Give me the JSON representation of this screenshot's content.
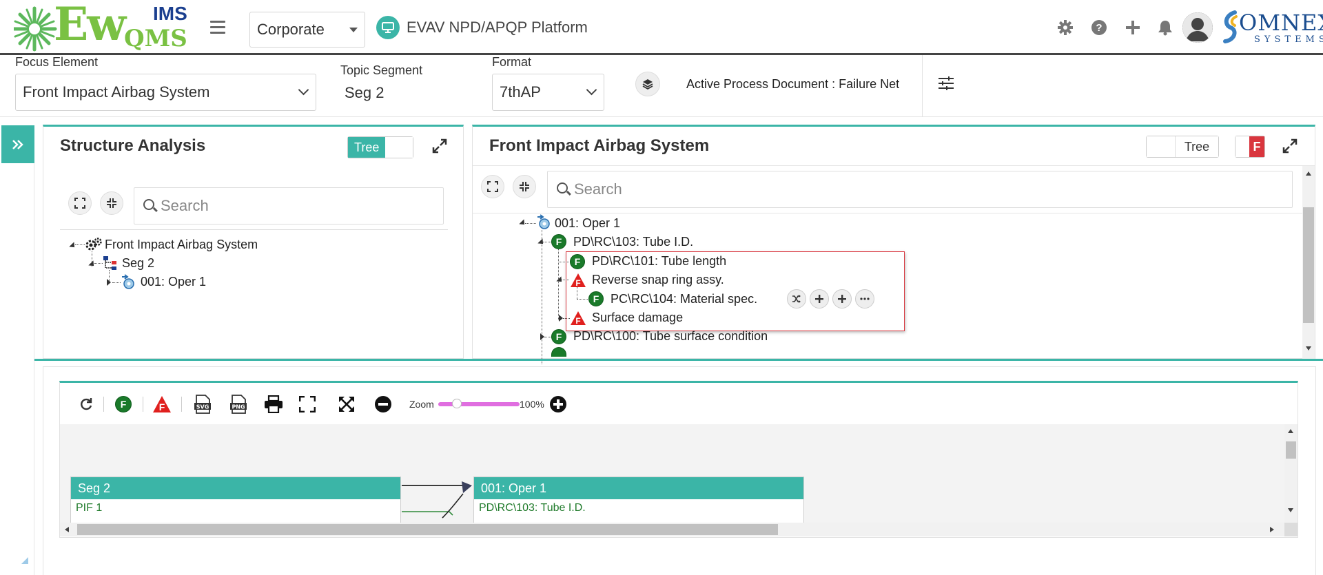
{
  "header": {
    "logo_main": "Ew",
    "logo_ims": "IMS",
    "logo_qms": "QMS",
    "company_select": "Corporate",
    "platform_title": "EVAV NPD/APQP Platform",
    "brand_name": "OMNEX",
    "brand_sub": "SYSTEMS",
    "icons": [
      "gear-icon",
      "help-icon",
      "plus-icon",
      "bell-icon",
      "avatar"
    ]
  },
  "focus_bar": {
    "focus_label": "Focus Element",
    "focus_value": "Front Impact Airbag System",
    "segment_label": "Topic Segment",
    "segment_value": "Seg 2",
    "format_label": "Format",
    "format_value": "7thAP",
    "active_doc": "Active Process Document : Failure Net"
  },
  "structure_panel": {
    "title": "Structure Analysis",
    "toggle_label": "Tree",
    "search_placeholder": "Search",
    "tree": [
      {
        "label": "Front Impact Airbag System",
        "icon": "gears-icon"
      },
      {
        "label": "Seg 2",
        "icon": "hierarchy-icon"
      },
      {
        "label": "001: Oper 1",
        "icon": "process-icon"
      }
    ]
  },
  "net_panel": {
    "title": "Front Impact Airbag System",
    "toggle_label": "Tree",
    "f_toggle": "F",
    "search_placeholder": "Search",
    "tree": [
      {
        "label": "001: Oper 1",
        "icon": "process-icon"
      },
      {
        "label": "PD\\RC\\103: Tube I.D.",
        "icon": "function-icon"
      },
      {
        "label": "PD\\RC\\101: Tube length",
        "icon": "function-icon"
      },
      {
        "label": "Reverse snap ring assy.",
        "icon": "failure-icon"
      },
      {
        "label": "PC\\RC\\104: Material spec.",
        "icon": "function-icon"
      },
      {
        "label": "Surface damage",
        "icon": "failure-icon"
      },
      {
        "label": "PD\\RC\\100: Tube surface condition",
        "icon": "function-icon"
      }
    ],
    "row_actions": [
      "shuffle-icon",
      "plus-icon",
      "plus-icon",
      "more-icon"
    ]
  },
  "diagram": {
    "zoom_label": "Zoom",
    "zoom_value": "100%",
    "zoom_level_pct": 100,
    "toolbar": [
      "refresh-icon",
      "function-icon",
      "failure-icon",
      "svg-export-icon",
      "png-export-icon",
      "print-icon",
      "fullscreen-icon",
      "fit-icon",
      "zoom-out-icon",
      "zoom-in-icon"
    ],
    "nodes": [
      {
        "title": "Seg 2",
        "rows": [
          "PIF 1"
        ]
      },
      {
        "title": "001: Oper 1",
        "rows": [
          "PD\\RC\\103: Tube I.D."
        ]
      }
    ]
  },
  "colors": {
    "teal": "#3bb5a7",
    "function_green": "#1a7a2a",
    "failure_red": "#e0201e",
    "highlight_border": "#d9363e"
  }
}
